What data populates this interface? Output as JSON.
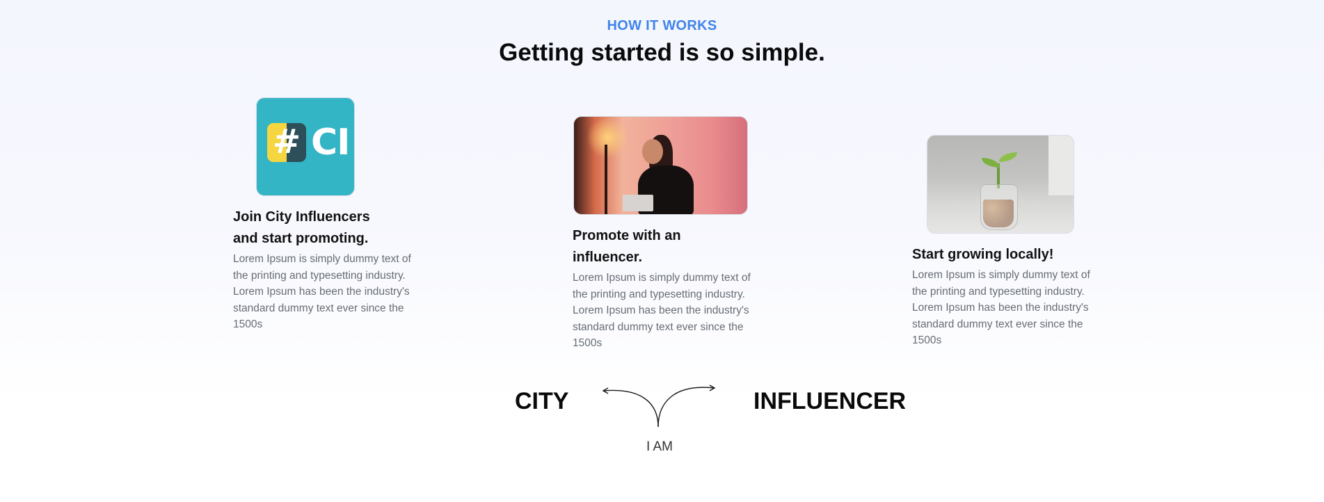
{
  "section": {
    "eyebrow": "HOW IT WORKS",
    "headline": "Getting started is so simple."
  },
  "steps": [
    {
      "title_line1": "Join City Influencers",
      "title_line2": "and start promoting.",
      "text": "Lorem Ipsum is simply dummy text of the printing and typesetting industry. Lorem Ipsum has been the industry's standard dummy text ever since the 1500s",
      "image": "city-influencers-logo",
      "logo_text": "CI",
      "logo_hash": "#"
    },
    {
      "title_line1": "Promote with an",
      "title_line2": "influencer.",
      "text": "Lorem Ipsum is simply dummy text of the printing and typesetting industry. Lorem Ipsum has been the industry's standard dummy text ever since the 1500s",
      "image": "woman-taking-selfie-photo"
    },
    {
      "title_line1": "Start growing locally!",
      "text": "Lorem Ipsum is simply dummy text of the printing and typesetting industry. Lorem Ipsum has been the industry's standard dummy text ever since the 1500s",
      "image": "plant-growing-from-coins-jar-photo"
    }
  ],
  "chooser": {
    "option_left": "CITY",
    "option_right": "INFLUENCER",
    "prompt": "I AM"
  },
  "colors": {
    "accent": "#3f84e9",
    "logo_bg": "#33b5c6",
    "logo_yellow": "#f5d540",
    "logo_dark": "#2c4f5a"
  }
}
